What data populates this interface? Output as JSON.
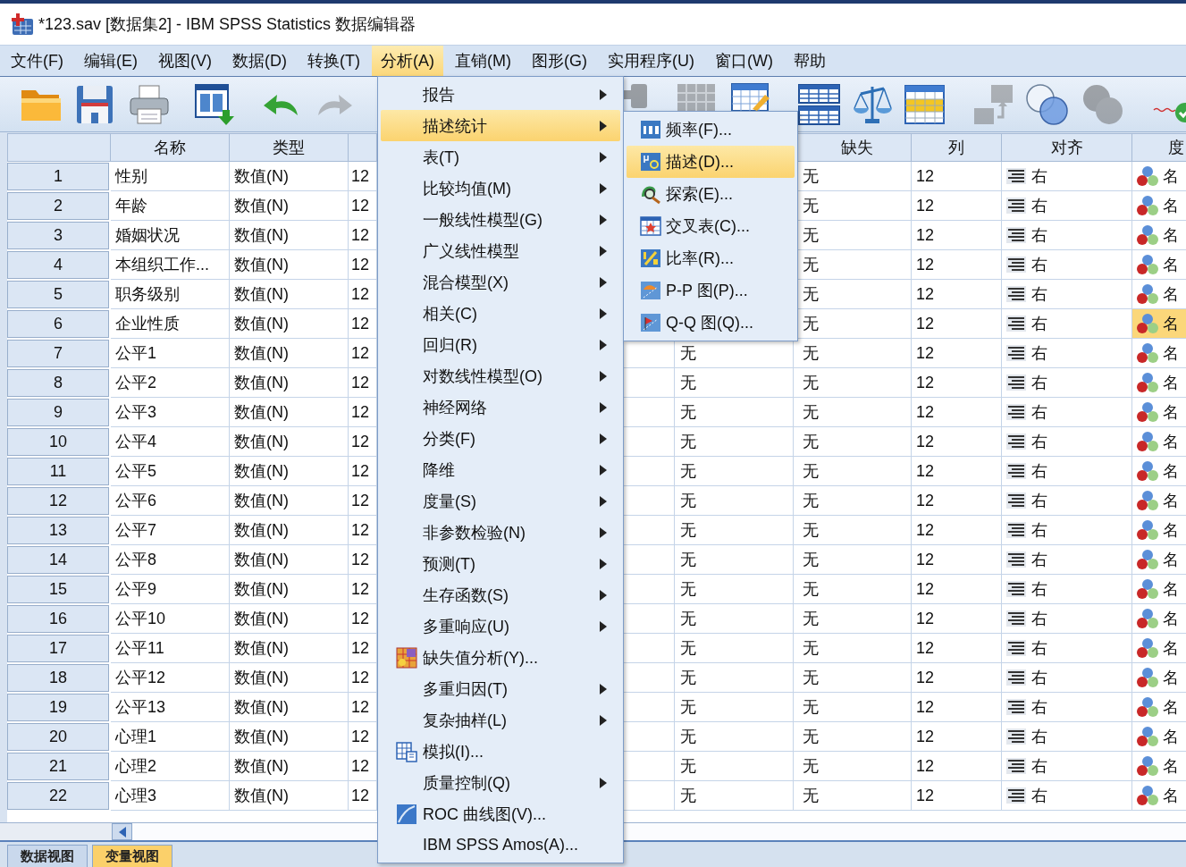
{
  "window": {
    "title": "*123.sav [数据集2] - IBM SPSS Statistics 数据编辑器"
  },
  "menu_bar": [
    {
      "label": "文件(F)",
      "selected": false
    },
    {
      "label": "编辑(E)",
      "selected": false
    },
    {
      "label": "视图(V)",
      "selected": false
    },
    {
      "label": "数据(D)",
      "selected": false
    },
    {
      "label": "转换(T)",
      "selected": false
    },
    {
      "label": "分析(A)",
      "selected": true
    },
    {
      "label": "直销(M)",
      "selected": false
    },
    {
      "label": "图形(G)",
      "selected": false
    },
    {
      "label": "实用程序(U)",
      "selected": false
    },
    {
      "label": "窗口(W)",
      "selected": false
    },
    {
      "label": "帮助",
      "selected": false
    }
  ],
  "toolbar": [
    {
      "disabled": false
    },
    {
      "disabled": false
    },
    {
      "disabled": false
    },
    {
      "disabled": false
    },
    {
      "disabled": false
    },
    {
      "disabled": true
    },
    {
      "disabled": true
    },
    {
      "disabled": true
    },
    {
      "disabled": false
    },
    {
      "disabled": false
    },
    {
      "disabled": false
    },
    {
      "disabled": false
    },
    {
      "disabled": true
    },
    {
      "disabled": false
    },
    {
      "disabled": true
    },
    {
      "disabled": false
    }
  ],
  "table": {
    "header": {
      "name": "名称",
      "type": "类型",
      "missing": "缺失",
      "columns": "列",
      "align": "对齐",
      "measure": "度"
    },
    "rows": [
      {
        "number": "1",
        "name": "性别",
        "type": "数值(N)",
        "column_3": "12",
        "missing": "无",
        "columns": "12",
        "align": "右",
        "measure": "名",
        "selected": false
      },
      {
        "number": "2",
        "name": "年龄",
        "type": "数值(N)",
        "column_3": "12",
        "missing": "无",
        "columns": "12",
        "align": "右",
        "measure": "名",
        "selected": false
      },
      {
        "number": "3",
        "name": "婚姻状况",
        "type": "数值(N)",
        "column_3": "12",
        "missing": "无",
        "columns": "12",
        "align": "右",
        "measure": "名",
        "selected": false
      },
      {
        "number": "4",
        "name": "本组织工作...",
        "type": "数值(N)",
        "column_3": "12",
        "missing": "无",
        "columns": "12",
        "align": "右",
        "measure": "名",
        "selected": false
      },
      {
        "number": "5",
        "name": "职务级别",
        "type": "数值(N)",
        "column_3": "12",
        "missing": "无",
        "columns": "12",
        "align": "右",
        "measure": "名",
        "selected": false
      },
      {
        "number": "6",
        "name": "企业性质",
        "type": "数值(N)",
        "column_3": "12",
        "missing": "无",
        "columns": "12",
        "align": "右",
        "measure": "名",
        "selected": true
      },
      {
        "number": "7",
        "name": "公平1",
        "type": "数值(N)",
        "column_3": "12",
        "column_6": "无",
        "missing": "无",
        "columns": "12",
        "align": "右",
        "measure": "名",
        "selected": false
      },
      {
        "number": "8",
        "name": "公平2",
        "type": "数值(N)",
        "column_3": "12",
        "column_6": "无",
        "missing": "无",
        "columns": "12",
        "align": "右",
        "measure": "名",
        "selected": false
      },
      {
        "number": "9",
        "name": "公平3",
        "type": "数值(N)",
        "column_3": "12",
        "column_6": "无",
        "missing": "无",
        "columns": "12",
        "align": "右",
        "measure": "名",
        "selected": false
      },
      {
        "number": "10",
        "name": "公平4",
        "type": "数值(N)",
        "column_3": "12",
        "column_6": "无",
        "missing": "无",
        "columns": "12",
        "align": "右",
        "measure": "名",
        "selected": false
      },
      {
        "number": "11",
        "name": "公平5",
        "type": "数值(N)",
        "column_3": "12",
        "column_6": "无",
        "missing": "无",
        "columns": "12",
        "align": "右",
        "measure": "名",
        "selected": false
      },
      {
        "number": "12",
        "name": "公平6",
        "type": "数值(N)",
        "column_3": "12",
        "column_6": "无",
        "missing": "无",
        "columns": "12",
        "align": "右",
        "measure": "名",
        "selected": false
      },
      {
        "number": "13",
        "name": "公平7",
        "type": "数值(N)",
        "column_3": "12",
        "column_6": "无",
        "missing": "无",
        "columns": "12",
        "align": "右",
        "measure": "名",
        "selected": false
      },
      {
        "number": "14",
        "name": "公平8",
        "type": "数值(N)",
        "column_3": "12",
        "column_6": "无",
        "missing": "无",
        "columns": "12",
        "align": "右",
        "measure": "名",
        "selected": false
      },
      {
        "number": "15",
        "name": "公平9",
        "type": "数值(N)",
        "column_3": "12",
        "column_6": "无",
        "missing": "无",
        "columns": "12",
        "align": "右",
        "measure": "名",
        "selected": false
      },
      {
        "number": "16",
        "name": "公平10",
        "type": "数值(N)",
        "column_3": "12",
        "column_6": "无",
        "missing": "无",
        "columns": "12",
        "align": "右",
        "measure": "名",
        "selected": false
      },
      {
        "number": "17",
        "name": "公平11",
        "type": "数值(N)",
        "column_3": "12",
        "column_6": "无",
        "missing": "无",
        "columns": "12",
        "align": "右",
        "measure": "名",
        "selected": false
      },
      {
        "number": "18",
        "name": "公平12",
        "type": "数值(N)",
        "column_3": "12",
        "column_6": "无",
        "missing": "无",
        "columns": "12",
        "align": "右",
        "measure": "名",
        "selected": false
      },
      {
        "number": "19",
        "name": "公平13",
        "type": "数值(N)",
        "column_3": "12",
        "column_6": "无",
        "missing": "无",
        "columns": "12",
        "align": "右",
        "measure": "名",
        "selected": false
      },
      {
        "number": "20",
        "name": "心理1",
        "type": "数值(N)",
        "column_3": "12",
        "column_6": "无",
        "missing": "无",
        "columns": "12",
        "align": "右",
        "measure": "名",
        "selected": false
      },
      {
        "number": "21",
        "name": "心理2",
        "type": "数值(N)",
        "column_3": "12",
        "column_6": "无",
        "missing": "无",
        "columns": "12",
        "align": "右",
        "measure": "名",
        "selected": false
      },
      {
        "number": "22",
        "name": "心理3",
        "type": "数值(N)",
        "column_3": "12",
        "column_6": "无",
        "missing": "无",
        "columns": "12",
        "align": "右",
        "measure": "名",
        "selected": false
      }
    ]
  },
  "view_tabs": [
    {
      "label": "数据视图",
      "selected": false
    },
    {
      "label": "变量视图",
      "selected": true
    }
  ],
  "analyze_menu": {
    "items": [
      {
        "label": "报告",
        "kind": "submenu",
        "selected": false
      },
      {
        "label": "描述统计",
        "kind": "submenu",
        "selected": true
      },
      {
        "label": "表(T)",
        "kind": "submenu",
        "selected": false
      },
      {
        "label": "比较均值(M)",
        "kind": "submenu",
        "selected": false
      },
      {
        "label": "一般线性模型(G)",
        "kind": "submenu",
        "selected": false
      },
      {
        "label": "广义线性模型",
        "kind": "submenu",
        "selected": false
      },
      {
        "label": "混合模型(X)",
        "kind": "submenu",
        "selected": false
      },
      {
        "label": "相关(C)",
        "kind": "submenu",
        "selected": false
      },
      {
        "label": "回归(R)",
        "kind": "submenu",
        "selected": false
      },
      {
        "label": "对数线性模型(O)",
        "kind": "submenu",
        "selected": false
      },
      {
        "label": "神经网络",
        "kind": "submenu",
        "selected": false
      },
      {
        "label": "分类(F)",
        "kind": "submenu",
        "selected": false
      },
      {
        "label": "降维",
        "kind": "submenu",
        "selected": false
      },
      {
        "label": "度量(S)",
        "kind": "submenu",
        "selected": false
      },
      {
        "label": "非参数检验(N)",
        "kind": "submenu",
        "selected": false
      },
      {
        "label": "预测(T)",
        "kind": "submenu",
        "selected": false
      },
      {
        "label": "生存函数(S)",
        "kind": "submenu",
        "selected": false
      },
      {
        "label": "多重响应(U)",
        "kind": "submenu",
        "selected": false
      },
      {
        "label": "缺失值分析(Y)...",
        "kind": "dialog",
        "selected": false
      },
      {
        "label": "多重归因(T)",
        "kind": "submenu",
        "selected": false
      },
      {
        "label": "复杂抽样(L)",
        "kind": "submenu",
        "selected": false
      },
      {
        "label": "模拟(I)...",
        "kind": "dialog",
        "selected": false
      },
      {
        "label": "质量控制(Q)",
        "kind": "submenu",
        "selected": false
      },
      {
        "label": "ROC 曲线图(V)...",
        "kind": "dialog",
        "selected": false
      },
      {
        "label": "IBM SPSS Amos(A)...",
        "kind": "plain",
        "selected": false
      }
    ]
  },
  "descriptive_submenu": {
    "items": [
      {
        "label": "频率(F)...",
        "selected": false
      },
      {
        "label": "描述(D)...",
        "selected": true
      },
      {
        "label": "探索(E)...",
        "selected": false
      },
      {
        "label": "交叉表(C)...",
        "selected": false
      },
      {
        "label": "比率(R)...",
        "selected": false
      },
      {
        "label": "P-P 图(P)...",
        "selected": false
      },
      {
        "label": "Q-Q 图(Q)...",
        "selected": false
      }
    ]
  }
}
